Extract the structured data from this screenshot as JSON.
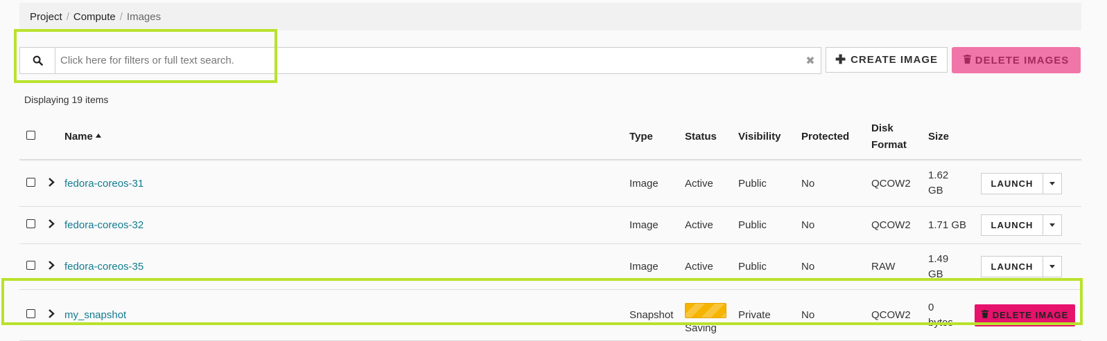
{
  "breadcrumb": {
    "project": "Project",
    "compute": "Compute",
    "images": "Images"
  },
  "search": {
    "placeholder": "Click here for filters or full text search."
  },
  "toolbar": {
    "create_label": "CREATE IMAGE",
    "delete_label": "DELETE IMAGES"
  },
  "summary": {
    "count_text": "Displaying 19 items"
  },
  "columns": {
    "name": "Name",
    "type": "Type",
    "status": "Status",
    "visibility": "Visibility",
    "protected": "Protected",
    "disk_format_1": "Disk",
    "disk_format_2": "Format",
    "size": "Size"
  },
  "rows": [
    {
      "name": "fedora-coreos-31",
      "type": "Image",
      "status": "Active",
      "visibility": "Public",
      "protected": "No",
      "disk_format": "QCOW2",
      "size_1": "1.62",
      "size_2": "GB",
      "action": "LAUNCH"
    },
    {
      "name": "fedora-coreos-32",
      "type": "Image",
      "status": "Active",
      "visibility": "Public",
      "protected": "No",
      "disk_format": "QCOW2",
      "size_1": "1.71 GB",
      "size_2": "",
      "action": "LAUNCH"
    },
    {
      "name": "fedora-coreos-35",
      "type": "Image",
      "status": "Active",
      "visibility": "Public",
      "protected": "No",
      "disk_format": "RAW",
      "size_1": "1.49",
      "size_2": "GB",
      "action": "LAUNCH"
    },
    {
      "name": "my_snapshot",
      "type": "Snapshot",
      "status": "Saving",
      "visibility": "Private",
      "protected": "No",
      "disk_format": "QCOW2",
      "size_1": "0",
      "size_2": "bytes",
      "action": "DELETE IMAGE"
    }
  ],
  "colors": {
    "link": "#127b8f",
    "delete_accent": "#e6126c",
    "delete_disabled": "#f075a9",
    "highlight": "#b9e22c",
    "saving": "#f6b400"
  },
  "icons": {
    "search": "search-icon",
    "clear": "clear-x-icon",
    "create": "plus-icon",
    "delete": "trash-icon",
    "expand": "chevron-right-icon",
    "dropdown": "caret-down-icon",
    "sort": "sort-ascending-icon"
  }
}
